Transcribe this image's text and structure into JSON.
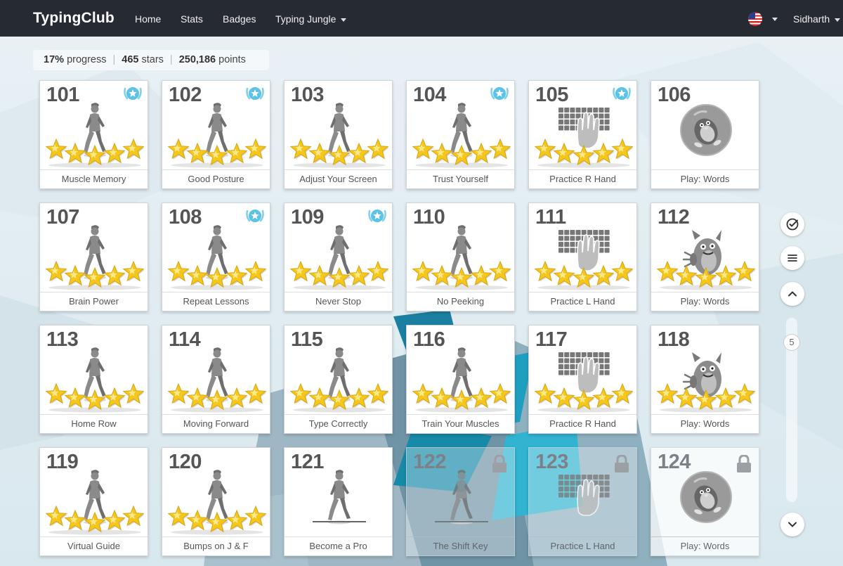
{
  "navbar": {
    "brand": "TypingClub",
    "links": [
      "Home",
      "Stats",
      "Badges",
      "Typing Jungle"
    ],
    "user": "Sidharth",
    "flag_icon": "us-flag-icon"
  },
  "progress": {
    "percent": "17%",
    "percent_label": "progress",
    "stars": "465",
    "stars_label": "stars",
    "points": "250,186",
    "points_label": "points"
  },
  "lessons": [
    {
      "num": "101",
      "title": "Muscle Memory",
      "icon": "walker",
      "stars": 5,
      "badge": true,
      "locked": false
    },
    {
      "num": "102",
      "title": "Good Posture",
      "icon": "walker",
      "stars": 5,
      "badge": true,
      "locked": false
    },
    {
      "num": "103",
      "title": "Adjust Your Screen",
      "icon": "walker",
      "stars": 5,
      "badge": false,
      "locked": false
    },
    {
      "num": "104",
      "title": "Trust Yourself",
      "icon": "walker",
      "stars": 5,
      "badge": true,
      "locked": false
    },
    {
      "num": "105",
      "title": "Practice R Hand",
      "icon": "keyboard",
      "stars": 5,
      "badge": true,
      "locked": false
    },
    {
      "num": "106",
      "title": "Play: Words",
      "icon": "penguin-ball",
      "stars": 0,
      "badge": false,
      "locked": false
    },
    {
      "num": "107",
      "title": "Brain Power",
      "icon": "walker",
      "stars": 5,
      "badge": false,
      "locked": false
    },
    {
      "num": "108",
      "title": "Repeat Lessons",
      "icon": "walker",
      "stars": 5,
      "badge": true,
      "locked": false
    },
    {
      "num": "109",
      "title": "Never Stop",
      "icon": "walker",
      "stars": 5,
      "badge": true,
      "locked": false
    },
    {
      "num": "110",
      "title": "No Peeking",
      "icon": "walker",
      "stars": 5,
      "badge": false,
      "locked": false
    },
    {
      "num": "111",
      "title": "Practice L Hand",
      "icon": "keyboard",
      "stars": 5,
      "badge": false,
      "locked": false
    },
    {
      "num": "112",
      "title": "Play: Words",
      "icon": "monster",
      "stars": 5,
      "badge": false,
      "locked": false
    },
    {
      "num": "113",
      "title": "Home Row",
      "icon": "walker",
      "stars": 5,
      "badge": false,
      "locked": false
    },
    {
      "num": "114",
      "title": "Moving Forward",
      "icon": "walker",
      "stars": 5,
      "badge": false,
      "locked": false
    },
    {
      "num": "115",
      "title": "Type Correctly",
      "icon": "walker",
      "stars": 5,
      "badge": false,
      "locked": false
    },
    {
      "num": "116",
      "title": "Train Your Muscles",
      "icon": "walker",
      "stars": 5,
      "badge": false,
      "locked": false
    },
    {
      "num": "117",
      "title": "Practice R Hand",
      "icon": "keyboard",
      "stars": 5,
      "badge": false,
      "locked": false
    },
    {
      "num": "118",
      "title": "Play: Words",
      "icon": "monster",
      "stars": 5,
      "badge": false,
      "locked": false
    },
    {
      "num": "119",
      "title": "Virtual Guide",
      "icon": "walker",
      "stars": 5,
      "badge": false,
      "locked": false
    },
    {
      "num": "120",
      "title": "Bumps on J & F",
      "icon": "walker",
      "stars": 5,
      "badge": false,
      "locked": false
    },
    {
      "num": "121",
      "title": "Become a Pro",
      "icon": "walker-line",
      "stars": 0,
      "badge": false,
      "locked": false
    },
    {
      "num": "122",
      "title": "The Shift Key",
      "icon": "walker-line",
      "stars": 0,
      "badge": false,
      "locked": true
    },
    {
      "num": "123",
      "title": "Practice L Hand",
      "icon": "keyboard",
      "stars": 0,
      "badge": false,
      "locked": true
    },
    {
      "num": "124",
      "title": "Play: Words",
      "icon": "penguin-ball",
      "stars": 0,
      "badge": false,
      "locked": true
    }
  ],
  "side_controls": {
    "page_number": "5",
    "icons": [
      "check-circle-icon",
      "menu-icon",
      "chevron-up-icon",
      "chevron-down-icon"
    ]
  },
  "colors": {
    "navbar": "#262a33",
    "star": "#f5c61b",
    "badge": "#5cc3e8",
    "figure": "#8a8a8a"
  }
}
